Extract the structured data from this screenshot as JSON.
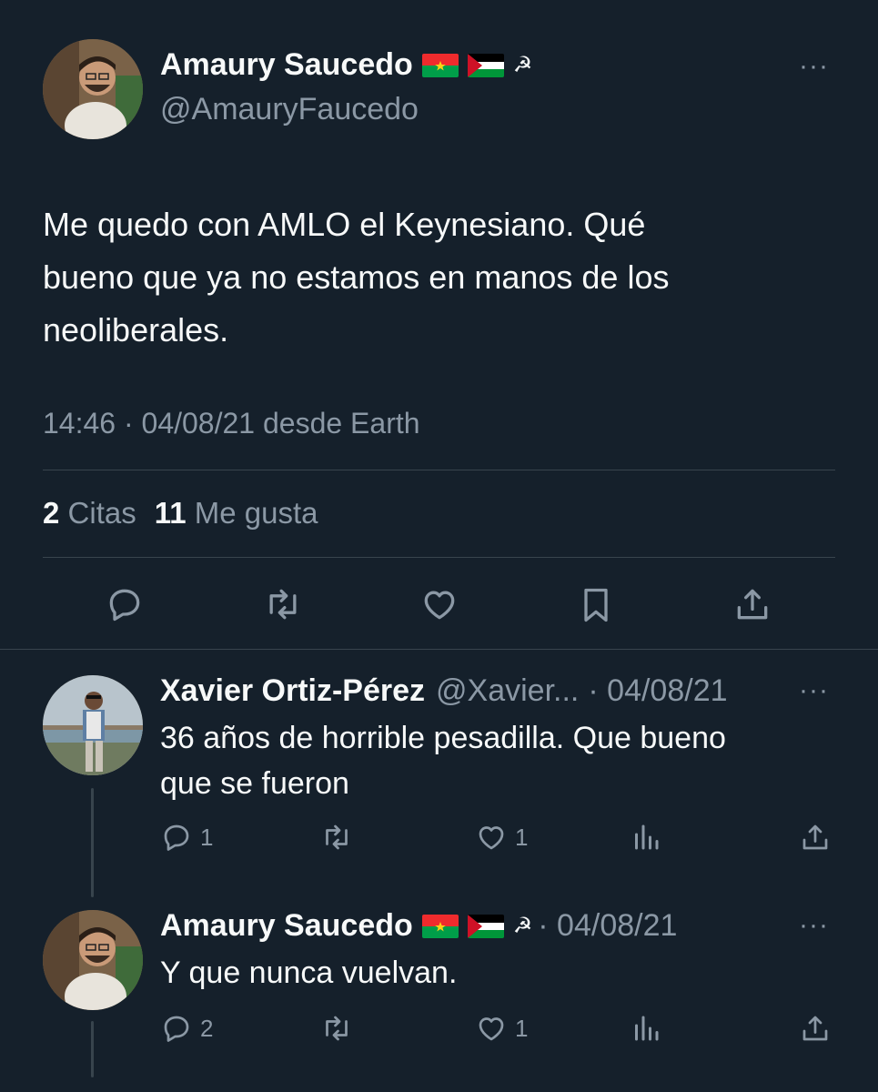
{
  "main_tweet": {
    "author_name": "Amaury Saucedo",
    "author_handle": "@AmauryFaucedo",
    "body_lines": [
      "Me quedo con AMLO el Keynesiano. Qué",
      "bueno que ya no estamos en manos de los",
      "neoliberales."
    ],
    "meta": "14:46 · 04/08/21 desde Earth",
    "quotes_count": "2",
    "quotes_label": "Citas",
    "likes_count": "11",
    "likes_label": "Me gusta",
    "more": "···"
  },
  "replies": [
    {
      "author_name": "Xavier Ortiz-Pérez",
      "author_handle": "@Xavier...",
      "date": "· 04/08/21",
      "body_lines": [
        "36 años de horrible pesadilla. Que bueno",
        "que se fueron"
      ],
      "reply_count": "1",
      "retweet_count": "",
      "like_count": "1",
      "more": "···"
    },
    {
      "author_name": "Amaury Saucedo",
      "author_handle": "",
      "date": "· 04/08/21",
      "body_lines": [
        "Y que nunca vuelvan."
      ],
      "reply_count": "2",
      "retweet_count": "",
      "like_count": "1",
      "more": "···"
    }
  ],
  "icons": {
    "flag1": "burkina-faso-flag-icon",
    "flag2": "palestine-flag-icon",
    "symbol": "☭"
  },
  "colors": {
    "background": "#15202b",
    "text": "#f7f9f9",
    "muted": "#8b98a5",
    "divider": "#38444d"
  }
}
